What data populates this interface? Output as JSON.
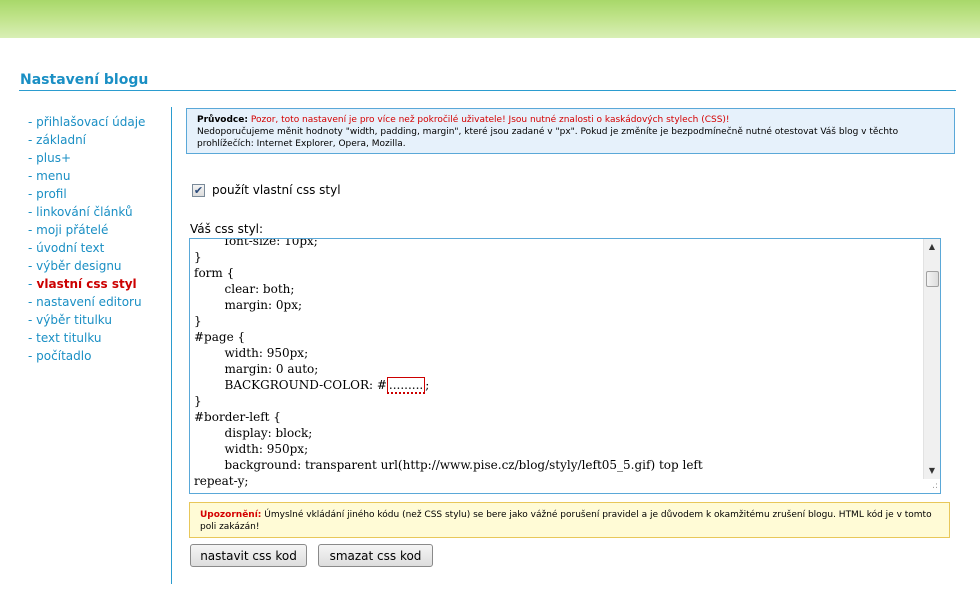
{
  "page": {
    "title": "Nastavení blogu"
  },
  "sidebar": {
    "dash": "-",
    "items": [
      {
        "label": "přihlašovací údaje"
      },
      {
        "label": "základní"
      },
      {
        "label": "plus+"
      },
      {
        "label": "menu"
      },
      {
        "label": "profil"
      },
      {
        "label": "linkování článků"
      },
      {
        "label": "moji přátelé"
      },
      {
        "label": "úvodní text"
      },
      {
        "label": "výběr designu"
      },
      {
        "label": "vlastní css styl",
        "active": true
      },
      {
        "label": "nastavení editoru"
      },
      {
        "label": "výběr titulku"
      },
      {
        "label": "text titulku"
      },
      {
        "label": "počítadlo"
      }
    ]
  },
  "guide": {
    "label": "Průvodce:",
    "warning": "Pozor, toto nastavení je pro více než pokročilé uživatele! Jsou nutné znalosti o kaskádových stylech (CSS)!",
    "text": "Nedoporučujeme měnit hodnoty \"width, padding, margin\", které jsou zadané v \"px\". Pokud je změníte je bezpodmínečně nutné otestovat Váš blog v těchto prohlížečích: Internet Explorer, Opera, Mozilla."
  },
  "custom_css": {
    "checked": true,
    "check_mark": "✔",
    "label": "použít vlastní css styl"
  },
  "editor": {
    "label": "Váš css styl:",
    "code_before": "        font-size: 10px;\n}\nform {\n        clear: both;\n        margin: 0px;\n}\n#page {\n        width: 950px;\n        margin: 0 auto;\n        BACKGROUND-COLOR: #",
    "code_marked": ".........",
    "code_after": ";\n}\n#border-left {\n        display: block;\n        width: 950px;\n        background: transparent url(http://www.pise.cz/blog/styly/left05_5.gif) top left\nrepeat-y;",
    "scroll_up": "▲",
    "scroll_down": "▼",
    "grip": ".:"
  },
  "notice": {
    "label": "Upozornění:",
    "text": "Úmyslné vkládání jiného kódu (než CSS stylu) se bere jako vážné porušení pravidel a je důvodem k okamžitému zrušení blogu. HTML kód je v tomto poli zakázán!"
  },
  "buttons": {
    "set_label": "nastavit css kod",
    "delete_label": "smazat css kod"
  },
  "colors": {
    "accent": "#1a8fc4",
    "active": "#cc0000",
    "banner": "#bfe389",
    "guide_bg": "#e6f1fb",
    "notice_bg": "#fffbd6"
  }
}
